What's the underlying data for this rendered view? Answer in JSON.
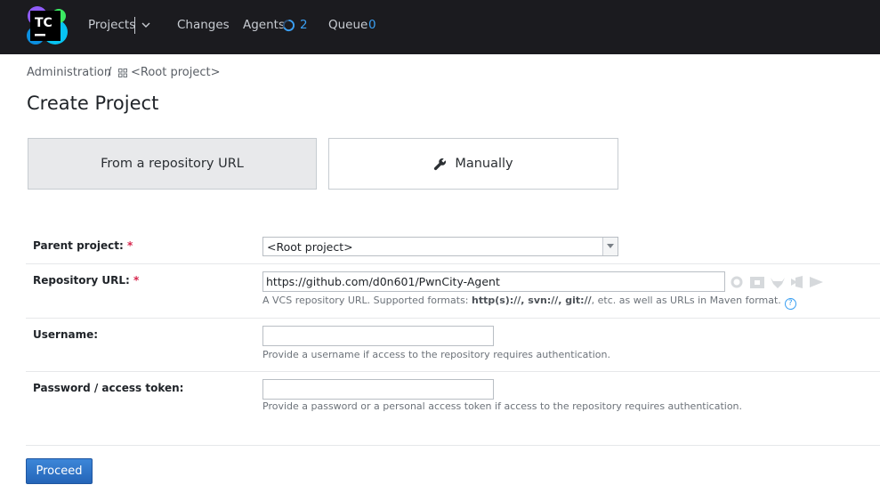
{
  "header": {
    "logo_text": "TC",
    "nav": {
      "projects": "Projects",
      "changes": "Changes",
      "agents": "Agents",
      "agents_count": "2",
      "queue": "Queue",
      "queue_count": "0"
    },
    "accent_color": "#3a9ff2",
    "bg_color": "#1b1b1f"
  },
  "breadcrumb": {
    "admin": "Administration",
    "separator": "/",
    "root": "<Root project>"
  },
  "page_title": "Create Project",
  "mode": {
    "from_url": "From a repository URL",
    "manually": "Manually",
    "selected": "From a repository URL"
  },
  "form": {
    "parent_project": {
      "label": "Parent project:",
      "required_mark": "*",
      "value": "<Root project>"
    },
    "repository_url": {
      "label": "Repository URL:",
      "required_mark": "*",
      "value": "https://github.com/d0n601/PwnCity-Agent",
      "hint_prefix": "A VCS repository URL. Supported formats: ",
      "hint_formats": "http(s)://, svn://, git://",
      "hint_suffix": ", etc. as well as URLs in Maven format.",
      "help_icon": "?"
    },
    "username": {
      "label": "Username:",
      "value": "",
      "hint": "Provide a username if access to the repository requires authentication."
    },
    "password": {
      "label": "Password / access token:",
      "value": "",
      "hint": "Provide a password or a personal access token if access to the repository requires authentication."
    },
    "vcs_icons": [
      "github-icon",
      "bitbucket-icon",
      "gitlab-icon",
      "azure-devops-icon",
      "space-icon"
    ]
  },
  "proceed_label": "Proceed"
}
